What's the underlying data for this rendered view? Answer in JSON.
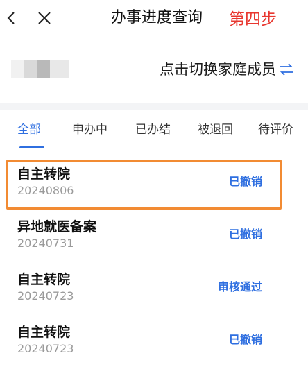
{
  "header": {
    "title": "办事进度查询",
    "step_note": "第四步",
    "back_icon": "chevron-left-icon",
    "close_icon": "close-icon"
  },
  "member": {
    "switch_label": "点击切换家庭成员",
    "switch_icon": "swap-arrows-icon"
  },
  "tabs": [
    {
      "label": "全部",
      "active": true
    },
    {
      "label": "申办中",
      "active": false
    },
    {
      "label": "已办结",
      "active": false
    },
    {
      "label": "被退回",
      "active": false
    },
    {
      "label": "待评价",
      "active": false
    }
  ],
  "items": [
    {
      "title": "自主转院",
      "date": "20240806",
      "status": "已撤销"
    },
    {
      "title": "异地就医备案",
      "date": "20240731",
      "status": "已撤销"
    },
    {
      "title": "自主转院",
      "date": "20240723",
      "status": "审核通过"
    },
    {
      "title": "自主转院",
      "date": "20240723",
      "status": "已撤销"
    }
  ],
  "colors": {
    "accent": "#2f6fe0",
    "step_note": "#e8372f",
    "highlight_border": "#f28b33"
  }
}
